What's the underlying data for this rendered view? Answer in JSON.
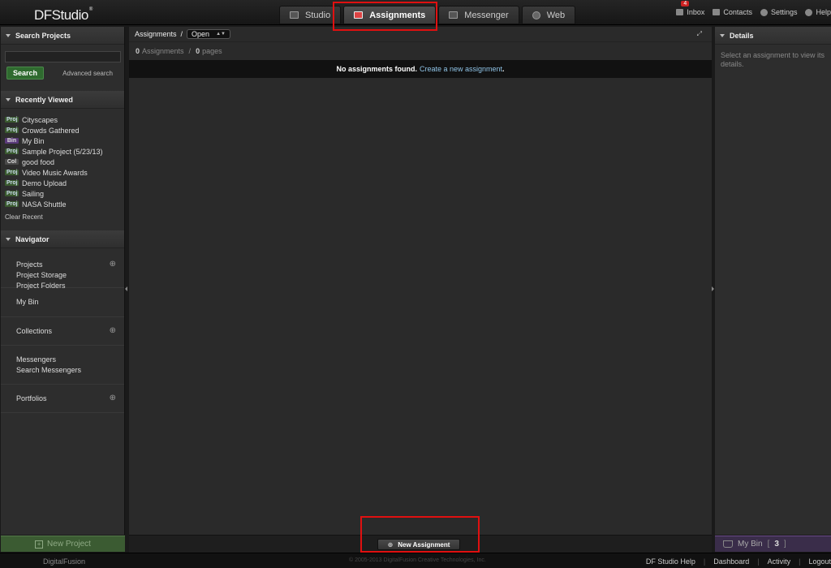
{
  "app": {
    "logo": "DFStudio",
    "logo_mark": "®"
  },
  "top_tabs": [
    {
      "label": "Studio",
      "icon": "studio-icon"
    },
    {
      "label": "Assignments",
      "icon": "assignments-icon",
      "active": true
    },
    {
      "label": "Messenger",
      "icon": "messenger-icon"
    },
    {
      "label": "Web",
      "icon": "globe-icon"
    }
  ],
  "top_links": {
    "inbox": "Inbox",
    "inbox_badge": "4",
    "contacts": "Contacts",
    "settings": "Settings",
    "help": "Help"
  },
  "left": {
    "search_title": "Search Projects",
    "search_button": "Search",
    "advanced": "Advanced search",
    "recent_title": "Recently Viewed",
    "recent": [
      {
        "tag": "Proj",
        "kind": "proj",
        "label": "Cityscapes"
      },
      {
        "tag": "Proj",
        "kind": "proj",
        "label": "Crowds Gathered"
      },
      {
        "tag": "Bin",
        "kind": "bin",
        "label": "My Bin"
      },
      {
        "tag": "Proj",
        "kind": "proj",
        "label": "Sample Project (5/23/13)"
      },
      {
        "tag": "Col",
        "kind": "col",
        "label": "good food"
      },
      {
        "tag": "Proj",
        "kind": "proj",
        "label": "Video Music Awards"
      },
      {
        "tag": "Proj",
        "kind": "proj",
        "label": "Demo Upload"
      },
      {
        "tag": "Proj",
        "kind": "proj",
        "label": "Sailing"
      },
      {
        "tag": "Proj",
        "kind": "proj",
        "label": "NASA Shuttle"
      }
    ],
    "clear_recent": "Clear Recent",
    "navigator_title": "Navigator",
    "nav": {
      "projects": "Projects",
      "project_storage": "Project Storage",
      "project_folders": "Project Folders",
      "my_bin": "My Bin",
      "collections": "Collections",
      "messengers": "Messengers",
      "search_messengers": "Search Messengers",
      "portfolios": "Portfolios"
    },
    "new_project": "New Project"
  },
  "center": {
    "crumb": "Assignments",
    "crumb_sep": "/",
    "filter_value": "Open",
    "count_assignments": "0",
    "count_assignments_label": "Assignments",
    "count_sep": "/",
    "count_pages": "0",
    "count_pages_label": "pages",
    "notice": "No assignments found.",
    "notice_link": "Create a new assignment",
    "notice_end": ".",
    "new_button": "New Assignment"
  },
  "right": {
    "title": "Details",
    "text": "Select an assignment to view its details.",
    "bin_label": "My Bin",
    "bin_count": "3"
  },
  "footer": {
    "brand": "DigitalFusion",
    "copyright": "© 2005-2013 DigitalFusion Creative Technologies, Inc.",
    "links": [
      "DF Studio Help",
      "Dashboard",
      "Activity",
      "Logout"
    ]
  },
  "colors": {
    "highlight": "#e01010",
    "link": "#8fc3e6",
    "new_project_bg": "#3b5b32",
    "my_bin_bg": "#3a2d4a"
  }
}
